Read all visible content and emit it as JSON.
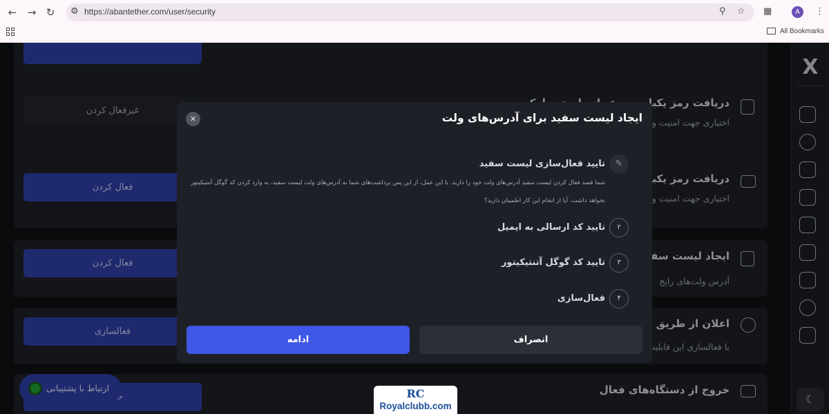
{
  "browser": {
    "url": "https://abantether.com/user/security",
    "profile_initial": "A",
    "bookmarks_label": "All Bookmarks",
    "icons": [
      "back-icon",
      "forward-icon",
      "reload-icon",
      "site-info-icon",
      "zoom-icon",
      "star-icon",
      "extensions-icon",
      "menu-icon",
      "apps-icon",
      "folder-icon"
    ]
  },
  "sidebar": {
    "logo": "X",
    "items": [
      "dashboard-icon",
      "link-icon",
      "transfer-icon",
      "wallet-icon",
      "card-icon",
      "exchange-icon",
      "bag-icon",
      "dollar-icon",
      "profile-icon"
    ],
    "theme_icon": "moon-icon"
  },
  "page": {
    "rows": [
      {
        "title": "دریافت رمز یکبار مصرف از طریق پیامک",
        "desc": "اختیاری جهت امنیت ور",
        "button": "غیرفعال کردن"
      },
      {
        "title": "دریافت رمز یکبار مصرف از طریق",
        "desc": "اختیاری جهت امنیت ور",
        "button": "فعال کردن"
      },
      {
        "title": "ایجاد لیست سفید",
        "desc": "آدرس ولت‌های رایج",
        "button": "فعال کردن"
      },
      {
        "title": "اعلان از طریق تلگرا",
        "desc": "با فعالسازی این قابلیت،",
        "button": "فعالسازی"
      },
      {
        "title": "خروج از دستگاه‌های فعال",
        "desc": "",
        "button": "خروج"
      }
    ],
    "support_label": "ارتباط با پشتیبانی"
  },
  "modal": {
    "title": "ایجاد لیست سفید برای آدرس‌های ولت",
    "close_icon": "close-icon",
    "steps": [
      {
        "number": "",
        "label": "تایید فعال‌سازی لیست سفید",
        "icon": "pencil-icon"
      },
      {
        "number": "۲",
        "label": "تایید کد ارسالی به ایمیل"
      },
      {
        "number": "۳",
        "label": "تایید کد گوگل آتنتیکیتور"
      },
      {
        "number": "۴",
        "label": "فعال‌سازی"
      }
    ],
    "description": "شما قصد فعال کردن لیست سفید آدرس‌های ولت خود را دارید. با این عمل، از این پس برداشت‌های شما به آدرس‌های ولت لیست سفید، به وارد کردن کد گوگل آتنتیکیتور نخواهد داشت. آیا از انجام این کار اطمینان دارید؟",
    "continue_label": "ادامه",
    "cancel_label": "انصراف",
    "colors": {
      "primary": "#3f56e6",
      "surface": "#1e2027"
    }
  },
  "watermark": {
    "logo": "RC",
    "text": "Royalclubb.com"
  }
}
